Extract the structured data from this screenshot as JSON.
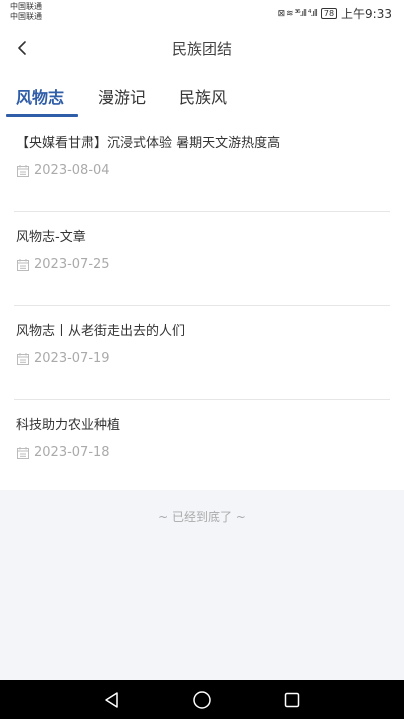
{
  "status_bar": {
    "carrier_1": "中国联通",
    "carrier_2": "中国联通",
    "signal_icons": "⊠ ≋ ³⁶.ıll ⁴.ıll",
    "battery": "78",
    "time": "上午9:33"
  },
  "nav": {
    "title": "民族团结"
  },
  "tabs": [
    {
      "label": "风物志",
      "active": true
    },
    {
      "label": "漫游记",
      "active": false
    },
    {
      "label": "民族风",
      "active": false
    }
  ],
  "articles": [
    {
      "title": "【央媒看甘肃】沉浸式体验 暑期天文游热度高",
      "date": "2023-08-04"
    },
    {
      "title": "风物志-文章",
      "date": "2023-07-25"
    },
    {
      "title": "风物志丨从老街走出去的人们",
      "date": "2023-07-19"
    },
    {
      "title": "科技助力农业种植",
      "date": "2023-07-18"
    }
  ],
  "footer": {
    "end_text": "~ 已经到底了 ~"
  },
  "colors": {
    "accent": "#2f5da8",
    "footer_bg": "#f3f5f9",
    "date_gray": "#aaaaaa"
  }
}
